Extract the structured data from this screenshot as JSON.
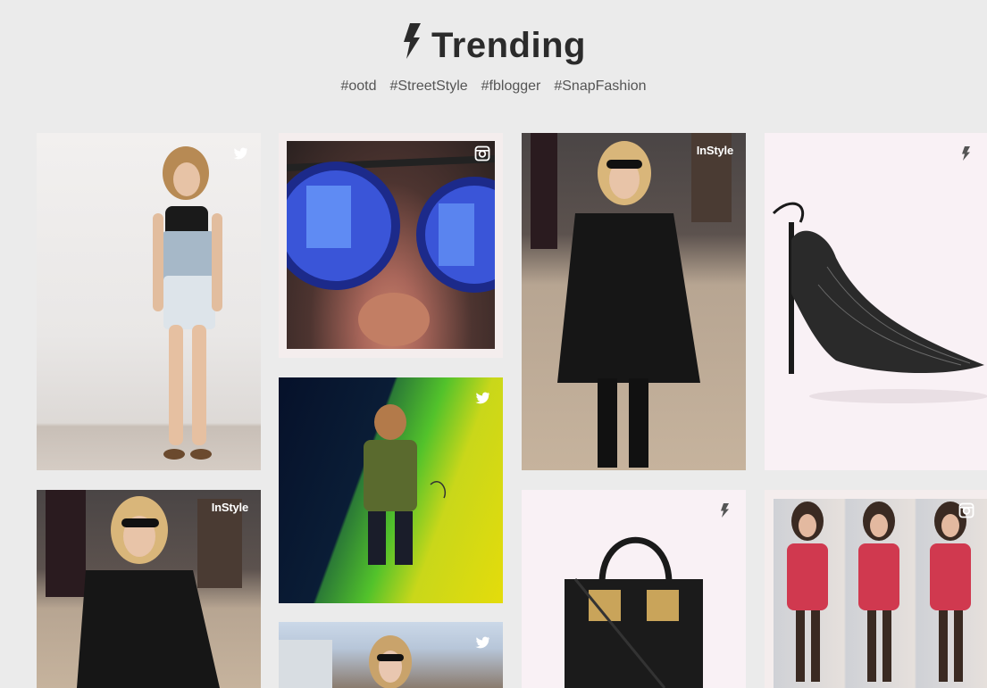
{
  "header": {
    "title": "Trending",
    "icon": "lightning-bolt-icon",
    "tags": [
      "#ootd",
      "#StreetStyle",
      "#fblogger",
      "#SnapFashion"
    ]
  },
  "cards": [
    {
      "source": "twitter",
      "icon": "twitter-bird-icon"
    },
    {
      "source": "instagram",
      "icon": "instagram-camera-icon"
    },
    {
      "source": "instyle",
      "brand": "InStyle"
    },
    {
      "source": "trending",
      "icon": "lightning-bolt-icon"
    },
    {
      "source": "instyle",
      "brand": "InStyle"
    },
    {
      "source": "twitter",
      "icon": "twitter-bird-icon"
    },
    {
      "source": "trending",
      "icon": "lightning-bolt-icon"
    },
    {
      "source": "instagram",
      "icon": "instagram-camera-icon"
    },
    {
      "source": "twitter",
      "icon": "twitter-bird-icon"
    }
  ],
  "colors": {
    "background": "#ebebeb",
    "title": "#2b2b2b",
    "tags": "#555555",
    "badge_light": "#ffffff",
    "badge_dark": "#555555"
  }
}
